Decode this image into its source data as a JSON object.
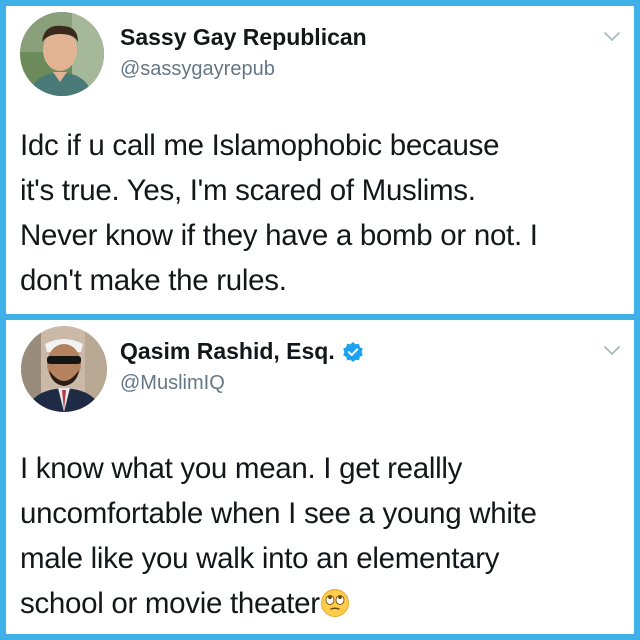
{
  "tweets": [
    {
      "display_name": "Sassy Gay Republican",
      "handle": "@sassygayrepub",
      "verified": false,
      "text_lines": [
        "Idc if u call me Islamophobic because",
        "it's true. Yes, I'm scared of Muslims.",
        "Never know if they have a bomb or not. I",
        "don't make the rules."
      ]
    },
    {
      "display_name": "Qasim Rashid, Esq.",
      "handle": "@MuslimIQ",
      "verified": true,
      "text_lines": [
        "I know what you mean. I get reallly",
        "uncomfortable when I see a young white",
        "male like you walk into an elementary",
        "school or movie theater"
      ],
      "trailing_emoji": "face-with-rolling-eyes"
    }
  ],
  "icons": {
    "chevron": "chevron-down-icon",
    "verified": "verified-badge-icon"
  },
  "colors": {
    "frame": "#3fb0e8",
    "verified_blue": "#1da1f2",
    "text": "#14171a",
    "secondary": "#657786"
  }
}
